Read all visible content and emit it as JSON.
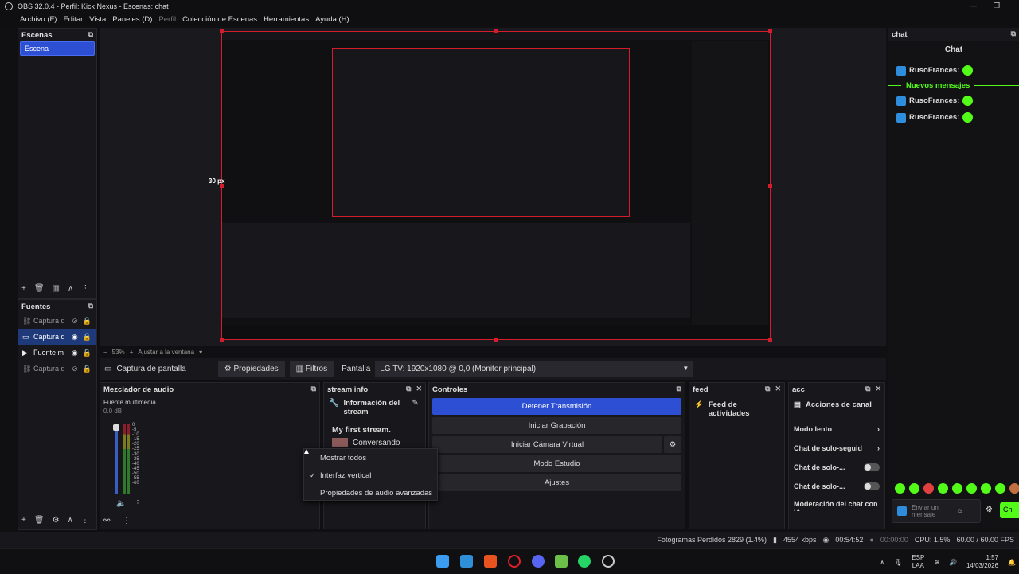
{
  "window": {
    "title": "OBS 32.0.4 - Perfil: Kick Nexus - Escenas: chat"
  },
  "menu": [
    "Archivo (F)",
    "Editar",
    "Vista",
    "Paneles (D)",
    "Perfil",
    "Colección de Escenas",
    "Herramientas",
    "Ayuda (H)"
  ],
  "scenes": {
    "title": "Escenas",
    "items": [
      "Escena"
    ]
  },
  "sources": {
    "title": "Fuentes",
    "items": [
      "Captura d",
      "Captura d",
      "Fuente m",
      "Captura d"
    ]
  },
  "preview": {
    "size_label": "30 px",
    "zoom": "53%",
    "fit_label": "Ajustar a la ventana"
  },
  "props": {
    "source": "Captura de pantalla",
    "properties": "Propiedades",
    "filters": "Filtros",
    "screen_label": "Pantalla",
    "screen_value": "LG TV: 1920x1080 @ 0,0 (Monitor principal)"
  },
  "mixer": {
    "title": "Mezclador de audio",
    "channel": "Fuente multimedia",
    "db": "0.0 dB",
    "scale": [
      "0",
      "-5",
      "-10",
      "-15",
      "-20",
      "-25",
      "-30",
      "-35",
      "-40",
      "-45",
      "-50",
      "-55",
      "-60"
    ]
  },
  "streaminfo": {
    "title": "stream info",
    "header": "Información del stream",
    "stream_title": "My first stream.",
    "category": "Conversando"
  },
  "context_menu": {
    "items": [
      {
        "label": "Mostrar todos",
        "checked": false
      },
      {
        "label": "Interfaz vertical",
        "checked": true
      },
      {
        "label": "Propiedades de audio avanzadas",
        "checked": false
      }
    ]
  },
  "controls": {
    "title": "Controles",
    "buttons": [
      "Detener Transmisión",
      "Iniciar Grabación",
      "Iniciar Cámara Virtual",
      "Modo Estudio",
      "Ajustes"
    ]
  },
  "feed": {
    "title": "feed",
    "header": "Feed de actividades"
  },
  "acc": {
    "title": "acc",
    "header": "Acciones de canal",
    "items": [
      "Modo lento",
      "Chat de solo-seguid",
      "Chat de solo-...",
      "Chat de solo-...",
      "Moderación del chat con IA"
    ]
  },
  "chat": {
    "title": "chat",
    "header": "Chat",
    "user": "RusoFrances:",
    "new_messages": "Nuevos mensajes",
    "placeholder": "Enviar un mensaje",
    "send": "Ch"
  },
  "status": {
    "dropped": "Fotogramas Perdidos 2829 (1.4%)",
    "bitrate": "4554 kbps",
    "stream_time": "00:54:52",
    "rec_time": "00:00:00",
    "cpu": "CPU: 1.5%",
    "fps": "60.00 / 60.00 FPS"
  },
  "tray": {
    "lang1": "ESP",
    "lang2": "LAA",
    "time": "1:57",
    "date": "14/03/2026"
  },
  "colors": {
    "accent": "#2c4fd3",
    "kick_green": "#53fc18",
    "selection_red": "#d31d2c"
  }
}
